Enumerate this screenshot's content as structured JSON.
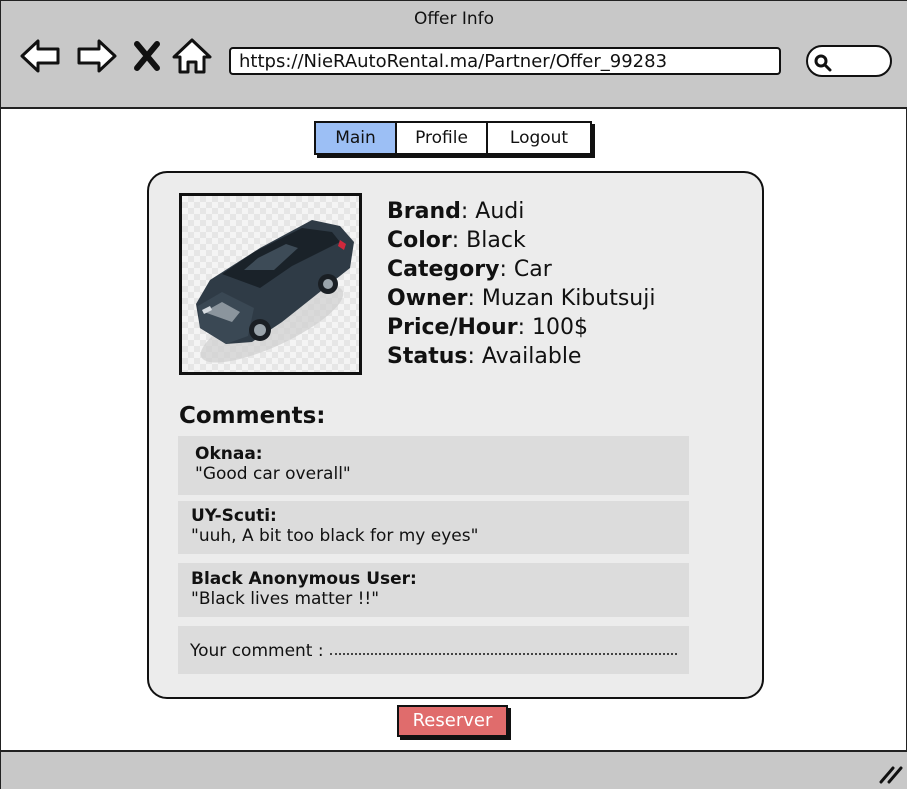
{
  "window": {
    "title": "Offer Info"
  },
  "browser": {
    "url": "https://NieRAutoRental.ma/Partner/Offer_99283",
    "search_placeholder": ""
  },
  "tabs": [
    {
      "label": "Main",
      "active": true
    },
    {
      "label": "Profile",
      "active": false
    },
    {
      "label": "Logout",
      "active": false
    }
  ],
  "offer": {
    "image_icon": "car-icon",
    "fields": [
      {
        "label": "Brand",
        "value": "Audi"
      },
      {
        "label": "Color",
        "value": "Black"
      },
      {
        "label": "Category",
        "value": "Car"
      },
      {
        "label": "Owner",
        "value": "Muzan Kibutsuji"
      },
      {
        "label": "Price/Hour",
        "value": "100$"
      },
      {
        "label": "Status",
        "value": "Available"
      }
    ]
  },
  "comments": {
    "heading": "Comments:",
    "items": [
      {
        "author": "Oknaa:",
        "text": "\"Good car overall\""
      },
      {
        "author": "UY-Scuti:",
        "text": "\"uuh, A bit too black for my eyes\""
      },
      {
        "author": "Black Anonymous User:",
        "text": "\"Black lives matter !!\""
      }
    ],
    "input_label": "Your comment :"
  },
  "actions": {
    "reserve_label": "Reserver"
  },
  "colors": {
    "active_tab": "#9cbff5",
    "reserve_button": "#e06c6c",
    "chrome": "#c8c8c8",
    "card": "#ececec"
  }
}
